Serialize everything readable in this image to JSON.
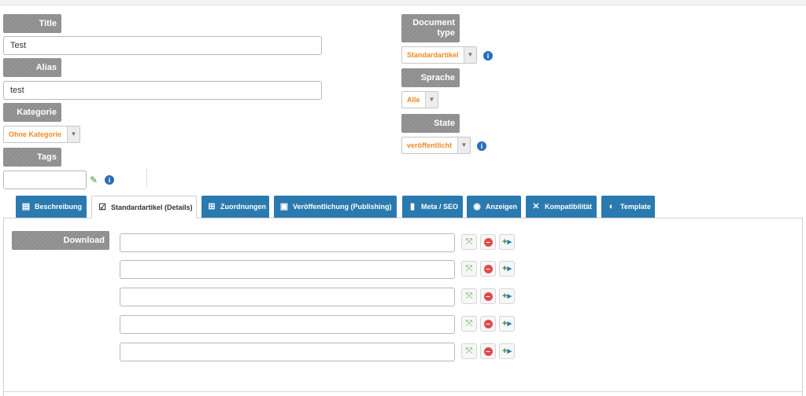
{
  "form": {
    "title_label": "Title",
    "title_value": "Test",
    "alias_label": "Alias",
    "alias_value": "test",
    "category_label": "Kategorie",
    "category_value": "Ohne Kategorie",
    "tags_label": "Tags",
    "doctype_label_line1": "Document",
    "doctype_label_line2": "type",
    "doctype_value": "Standardartikel",
    "language_label": "Sprache",
    "language_value": "Alle",
    "state_label": "State",
    "state_value": "veröffentlicht"
  },
  "tabs": [
    {
      "label": "Beschreibung",
      "icon": "document-icon"
    },
    {
      "label": "Standardartikel (Details)",
      "icon": "checklist-icon"
    },
    {
      "label": "Zuordnungen",
      "icon": "sitemap-icon"
    },
    {
      "label": "Veröffentlichung (Publishing)",
      "icon": "publish-icon"
    },
    {
      "label": "Meta / SEO",
      "icon": "bookmark-icon"
    },
    {
      "label": "Anzeigen",
      "icon": "eye-icon"
    },
    {
      "label": "Kompatibilität",
      "icon": "joomla-icon"
    },
    {
      "label": "Template",
      "icon": "palette-icon"
    }
  ],
  "details": {
    "download_label": "Download",
    "download_rows": [
      "",
      "",
      "",
      "",
      ""
    ]
  },
  "colors": {
    "tab_blue": "#2a7ab0",
    "label_gray": "#8d8d8d",
    "select_orange": "#f08a24",
    "info_blue": "#2a6ebb"
  }
}
